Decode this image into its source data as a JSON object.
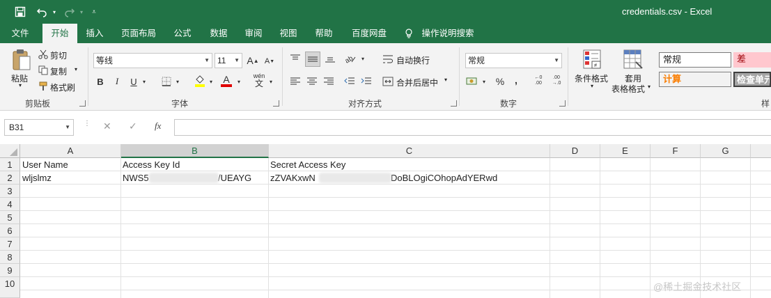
{
  "window": {
    "title": "credentials.csv  -  Excel"
  },
  "ribbon_tabs": [
    "文件",
    "开始",
    "插入",
    "页面布局",
    "公式",
    "数据",
    "审阅",
    "视图",
    "帮助",
    "百度网盘",
    "操作说明搜索"
  ],
  "clipboard": {
    "paste": "粘贴",
    "cut": "剪切",
    "copy": "复制",
    "format_painter": "格式刷",
    "group": "剪贴板"
  },
  "font": {
    "name": "等线",
    "size": "11",
    "group": "字体",
    "bold": "B",
    "italic": "I",
    "underline": "U",
    "grow": "A",
    "shrink": "A",
    "font_color_letter": "A"
  },
  "alignment": {
    "wrap_text": "自动换行",
    "merge_center": "合并后居中",
    "group": "对齐方式"
  },
  "number": {
    "format": "常规",
    "percent": "%",
    "comma": ",",
    "group": "数字"
  },
  "styles": {
    "conditional_format": "条件格式",
    "table_format_line1": "套用",
    "table_format_line2": "表格格式",
    "normal": "常规",
    "bad": "差",
    "calculation": "计算",
    "check_cell": "检查单元",
    "group_partial": "样"
  },
  "formula_bar": {
    "name_box": "B31",
    "fx": "fx",
    "formula": ""
  },
  "sheet": {
    "columns": [
      "A",
      "B",
      "C",
      "D",
      "E",
      "F",
      "G"
    ],
    "selected_column": "B",
    "rows": [
      "1",
      "2",
      "3",
      "4",
      "5",
      "6",
      "7",
      "8",
      "9",
      "10"
    ],
    "cells": {
      "A1": "User Name",
      "B1": "Access Key Id",
      "C1": "Secret Access Key",
      "A2": "wljslmz",
      "B2_left": "NWS5",
      "B2_right": "/UEAYG",
      "C2_left": "zZVAKxwN",
      "C2_right": "DoBLOgiCOhopAdYERwd"
    }
  },
  "watermark": "@稀土掘金技术社区",
  "colors": {
    "accent": "#217346"
  }
}
